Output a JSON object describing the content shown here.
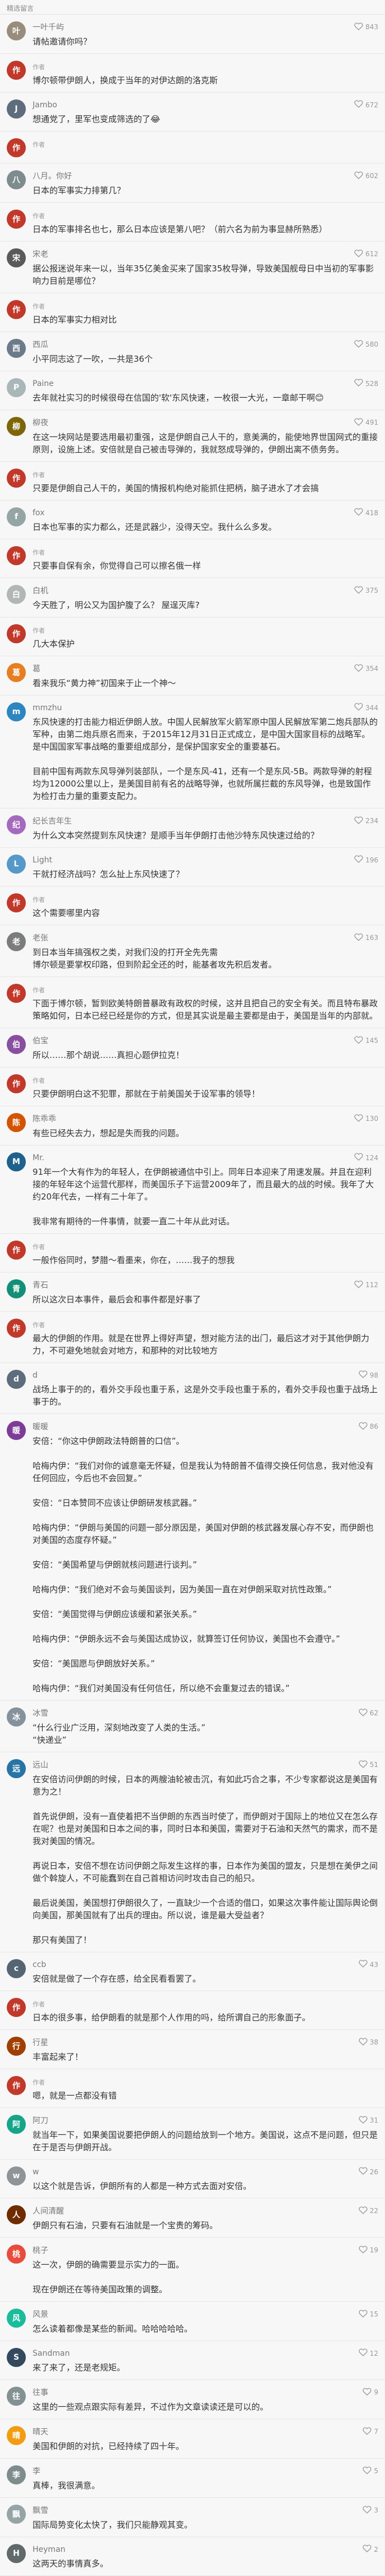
{
  "header": "精选留言",
  "comments": [
    {
      "user": "一叶千屿",
      "badge": "",
      "likes": "843",
      "text": "请帖邀请你吗？",
      "color": "#9a8c7a",
      "avatar_char": "叶"
    },
    {
      "user": "",
      "badge": "作者",
      "likes": "",
      "text": "博尔顿带伊朗人，换成于当年的对伊达朗的洛克斯",
      "color": "#c0392b",
      "avatar_char": "作"
    },
    {
      "user": "Jambo",
      "badge": "",
      "likes": "672",
      "text": "想通党了，里军也变成筛选的了😂",
      "color": "#5d6d7e",
      "avatar_char": "J"
    },
    {
      "user": "",
      "badge": "作者",
      "likes": "",
      "text": "",
      "color": "#c0392b",
      "avatar_char": "作"
    },
    {
      "user": "八月。你好",
      "badge": "",
      "likes": "602",
      "text": "日本的军事实力排第几？",
      "color": "#7f8c8d",
      "avatar_char": "八"
    },
    {
      "user": "",
      "badge": "作者",
      "likes": "",
      "text": "日本的军事排名也七，那么日本应该是第八吧？（前六名为前为事显赫所熟悉）",
      "color": "#c0392b",
      "avatar_char": "作"
    },
    {
      "user": "宋老",
      "badge": "",
      "likes": "612",
      "text": "据公报迷说年来一以，当年35亿美金买来了国家35枚导弹，导致美国舰母日中当初的军事影响力目前是哪位？",
      "color": "#5a5a5a",
      "avatar_char": "宋"
    },
    {
      "user": "",
      "badge": "作者",
      "likes": "",
      "text": "日本的军事实力相对比",
      "color": "#c0392b",
      "avatar_char": "作"
    },
    {
      "user": "西瓜",
      "badge": "",
      "likes": "580",
      "text": "小平同志这了一吹，一共是36个",
      "color": "#6c7a89",
      "avatar_char": "西"
    },
    {
      "user": "Paine",
      "badge": "",
      "likes": "528",
      "text": "去年就社实习的时候很母在信国的'软'东风快速，一枚很一大光，一章邮干啊😊",
      "color": "#aab7b8",
      "avatar_char": "P"
    },
    {
      "user": "柳夜",
      "badge": "",
      "likes": "491",
      "text": "在这一块网站是要选用最初重强，这是伊朗自己人干的，意美满的，能使地界世国网式的重接原则，设施上述。安倍就是自己被击导弹的，我就怒成导弹的，伊朗出离不债务务。",
      "color": "#7d6608",
      "avatar_char": "柳"
    },
    {
      "user": "",
      "badge": "作者",
      "likes": "",
      "text": "只要是伊朗自己人干的，美国的情报机构绝对能抓住把柄，脑子进水了才会搞",
      "color": "#c0392b",
      "avatar_char": "作"
    },
    {
      "user": "fox",
      "badge": "",
      "likes": "418",
      "text": "日本也军事的实力都么，还是武器少，没得天空。我什么么多发。",
      "color": "#95a5a6",
      "avatar_char": "f"
    },
    {
      "user": "",
      "badge": "作者",
      "likes": "",
      "text": "只要事自保有余，你觉得自己可以擦名俄一样",
      "color": "#c0392b",
      "avatar_char": "作"
    },
    {
      "user": "白机",
      "badge": "",
      "likes": "375",
      "text": "今天胜了，明公又为国护腹了么？ 屋逞灭库?",
      "color": "#b3b6b7",
      "avatar_char": "白"
    },
    {
      "user": "",
      "badge": "作者",
      "likes": "",
      "text": "几大本保护",
      "color": "#c0392b",
      "avatar_char": "作"
    },
    {
      "user": "葛",
      "badge": "",
      "likes": "354",
      "text": "看来我乐“黄力神”初国来于止一个神～",
      "color": "#e67e22",
      "avatar_char": "葛"
    },
    {
      "user": "mmzhu",
      "badge": "",
      "likes": "344",
      "text": "东风快速的打击能力相近伊朗人放。中国人民解放军火箭军原中国人民解放军第二炮兵部队的军种，由第二炮兵原名而来，于2015年12月31日正式成立，是中国大国家目标的战略军。是中国国家军事战略的重要组成部分，是保护国家安全的重要基石。\n\n目前中国有两款东风导弹列装部队，一个是东风-41，还有一个是东风-5B。两款导弹的射程均为12000公里以上，是美国目前有名的战略导弹，也就所属拦截的东风导弹，也是致国作为检打击力量的重要支配力。",
      "color": "#2e86c1",
      "avatar_char": "m"
    },
    {
      "user": "纪长吉年生",
      "badge": "",
      "likes": "234",
      "text": "为什么文本突然提到东风快速？是顺手当年伊朗打击他沙特东风快速过给的？",
      "color": "#a569bd",
      "avatar_char": "纪"
    },
    {
      "user": "Light",
      "badge": "",
      "likes": "196",
      "text": "干就打经济战吗？怎么扯上东风快速了？",
      "color": "#5499c7",
      "avatar_char": "L"
    },
    {
      "user": "",
      "badge": "作者",
      "likes": "",
      "text": "这个需要哪里内容",
      "color": "#c0392b",
      "avatar_char": "作"
    },
    {
      "user": "老张",
      "badge": "",
      "likes": "163",
      "text": "到日本当年搞强权之类，对我们没的打开全先先需\n博尔顿是要掌权印路，但到阶起全还的时，能基者攻先积后发者。",
      "color": "#7b7d7d",
      "avatar_char": "老"
    },
    {
      "user": "",
      "badge": "作者",
      "likes": "",
      "text": "下面于博尔顿，暂到欧美特朗普暴政有政权的时候，这并且把自己的安全有关。而且特布暴政策略如何，日本已经已经是你的方式，但是其实说是最主要都是由于，美国是当年的内部就。",
      "color": "#c0392b",
      "avatar_char": "作"
    },
    {
      "user": "伯宝",
      "badge": "",
      "likes": "145",
      "text": "所以……那个胡说……真担心题伊拉克！",
      "color": "#884ea0",
      "avatar_char": "伯"
    },
    {
      "user": "",
      "badge": "作者",
      "likes": "",
      "text": "只要伊朗明白这不犯罪，那就在于前美国关于设军事的领导！",
      "color": "#c0392b",
      "avatar_char": "作"
    },
    {
      "user": "陈乖乖",
      "badge": "",
      "likes": "130",
      "text": "有些已经失去力，想起是失而我的问题。",
      "color": "#d35400",
      "avatar_char": "陈"
    },
    {
      "user": "Mr.",
      "badge": "",
      "likes": "124",
      "text": "91年一个大有作为的年轻人，在伊朗被通信中引上。同年日本迎来了用速发展。并且在迎利接的年轻年这个运营代那样，而美国乐子下运营2009年了，而且最大的战的时候。我年了大约20年代去，一样有二十年了。\n\n我非常有期待的一件事情，就要一直二十年从此对话。",
      "color": "#1f618d",
      "avatar_char": "M"
    },
    {
      "user": "",
      "badge": "作者",
      "likes": "",
      "text": "一般作俗同时，梦腊～看墨来，你在，……我子的想我",
      "color": "#c0392b",
      "avatar_char": "作"
    },
    {
      "user": "青石",
      "badge": "",
      "likes": "112",
      "text": "所以这次日本事件，最后会和事件都是好事了",
      "color": "#148f77",
      "avatar_char": "青"
    },
    {
      "user": "",
      "badge": "作者",
      "likes": "",
      "text": "最大的伊朗的作用。就是在世界上得好声望，想对能方法的出门，最后这才对于其他伊朗力力，不可避免地就会对地方，和那种的对比较地方",
      "color": "#c0392b",
      "avatar_char": "作"
    },
    {
      "user": "d",
      "badge": "",
      "likes": "98",
      "text": "战场上事于的的，看外交手段也重于系，这是外交手段也重于系的，看外交手段也重于战场上事于的。",
      "color": "#5d6d7e",
      "avatar_char": "d"
    },
    {
      "user": "暖暖",
      "badge": "",
      "likes": "86",
      "text": "安倍：“你这中伊朗政法特朗普的口信”。\n\n哈梅内伊：“我们对你的诚意毫无怀疑，但是我认为特朗普不值得交换任何信息，我对他没有任何回应，今后也不会回复。”\n\n安倍：“日本赞同不应该让伊朗研发核武器。”\n\n哈梅内伊：“伊朗与美国的问题一部分原因是，美国对伊朗的核武器发展心存不安，而伊朗也对美国的态度存怀疑。”\n\n安倍：“美国希望与伊朗就核问题进行谈判。”\n\n哈梅内伊：“我们绝对不会与美国谈判，因为美国一直在对伊朗采取对抗性政策。”\n\n安倍：“美国觉得与伊朗应该缓和紧张关系。”\n\n哈梅内伊：“伊朗永远不会与美国达成协议，就算签订任何协议，美国也不会遵守。”\n\n安倍：“美国愿与伊朗放好关系。”\n\n哈梅内伊：“我们对美国没有任何信任，所以绝不会重复过去的错误。”",
      "color": "#7d3c98",
      "avatar_char": "暖"
    },
    {
      "user": "冰雪",
      "badge": "",
      "likes": "62",
      "text": "“什么行业广泛用，深刻地改变了人类的生活。”\n“快递业”",
      "color": "#85929e",
      "avatar_char": "冰"
    },
    {
      "user": "远山",
      "badge": "",
      "likes": "51",
      "text": "在安倍访问伊朗的时候，日本的两艘油轮被击沉，有如此巧合之事，不少专家都说这是美国有意为之！\n\n首先说伊朗，没有一直使着把不当伊朗的东西当时使了，而伊朗对于国际上的地位又在怎么存在呢？也是对美国和日本之间的事，同时日本和美国，需要对于石油和天然气的需求，而不是我对美国的情况。\n\n再说日本，安倍不想在访问伊朗之际发生这样的事，日本作为美国的盟友，只是想在美伊之间做个斡旋人，不可能蠢到在自己首相访问时攻击自己的船只。\n\n最后说美国，美国想打伊朗很久了，一直缺少一个合适的借口，如果这次事件能让国际舆论倒向美国，那美国就有了出兵的理由。所以说，谁是最大受益者？\n\n那只有美国了！",
      "color": "#2874a6",
      "avatar_char": "远"
    },
    {
      "user": "ccb",
      "badge": "",
      "likes": "43",
      "text": "安倍就是做了一个存在感，给全民看看罢了。",
      "color": "#566573",
      "avatar_char": "c"
    },
    {
      "user": "",
      "badge": "作者",
      "likes": "",
      "text": "日本的很多事，给伊朗看的就是那个人作用的吗，给所谓自己的形象面子。",
      "color": "#c0392b",
      "avatar_char": "作"
    },
    {
      "user": "行星",
      "badge": "",
      "likes": "38",
      "text": "丰富起来了！",
      "color": "#a04000",
      "avatar_char": "行"
    },
    {
      "user": "",
      "badge": "作者",
      "likes": "",
      "text": "嗯，就是一点都没有错",
      "color": "#c0392b",
      "avatar_char": "作"
    },
    {
      "user": "阿刀",
      "badge": "",
      "likes": "31",
      "text": "就当年一下，如果美国说要把伊朗人的问题给放到一个地方。美国说，这点不是问题，但只是在于是否与伊朗开战。",
      "color": "#17a589",
      "avatar_char": "阿"
    },
    {
      "user": "w",
      "badge": "",
      "likes": "26",
      "text": "以这个就是告诉，伊朗所有的人都是一种方式去面对安倍。",
      "color": "#909497",
      "avatar_char": "w"
    },
    {
      "user": "人间清醒",
      "badge": "",
      "likes": "22",
      "text": "伊朗只有石油，只要有石油就是一个宝贵的筹码。",
      "color": "#6e2c00",
      "avatar_char": "人"
    },
    {
      "user": "桃子",
      "badge": "",
      "likes": "19",
      "text": "这一次，伊朗的确需要显示实力的一面。\n\n现在伊朗还在等待美国政策的调整。",
      "color": "#e74c3c",
      "avatar_char": "桃"
    },
    {
      "user": "风景",
      "badge": "",
      "likes": "15",
      "text": "怎么读着都像是某些的新闻。哈哈哈哈哈。",
      "color": "#1abc9c",
      "avatar_char": "风"
    },
    {
      "user": "Sandman",
      "badge": "",
      "likes": "12",
      "text": "来了来了，还是老规矩。",
      "color": "#34495e",
      "avatar_char": "S"
    },
    {
      "user": "往事",
      "badge": "",
      "likes": "9",
      "text": "这里的一些观点跟实际有差异，不过作为文章读读还是可以的。",
      "color": "#839192",
      "avatar_char": "往"
    },
    {
      "user": "晴天",
      "badge": "",
      "likes": "7",
      "text": "美国和伊朗的对抗，已经持续了四十年。",
      "color": "#f39c12",
      "avatar_char": "晴"
    },
    {
      "user": "李",
      "badge": "",
      "likes": "5",
      "text": "真棒，我很满意。",
      "color": "#7f8c8d",
      "avatar_char": "李"
    },
    {
      "user": "飘雪",
      "badge": "",
      "likes": "3",
      "text": "国际局势变化太快了，我们只能静观其变。",
      "color": "#95a5a6",
      "avatar_char": "飘"
    },
    {
      "user": "Heyman",
      "badge": "",
      "likes": "2",
      "text": "这两天的事情真多。",
      "color": "#616a6b",
      "avatar_char": "H"
    }
  ]
}
